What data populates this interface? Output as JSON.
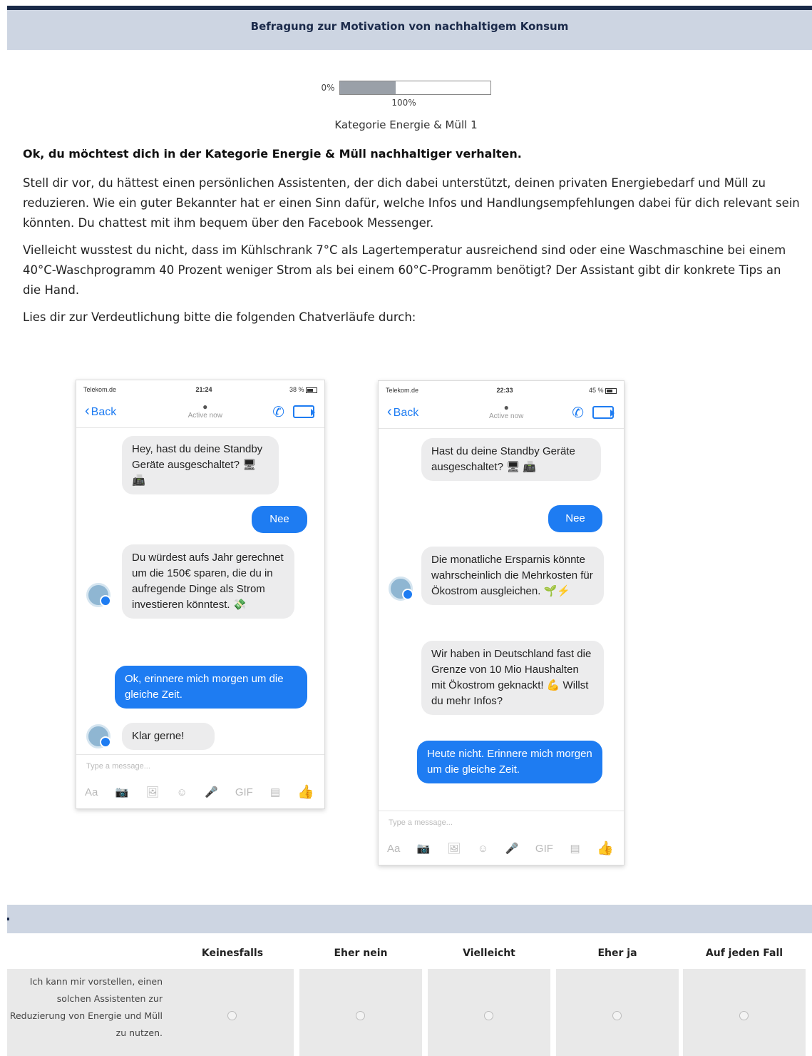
{
  "header": {
    "title": "Befragung zur Motivation von nachhaltigem Konsum"
  },
  "progress": {
    "min_label": "0%",
    "max_label": "100%",
    "fraction": 0.37
  },
  "category": "Kategorie Energie & Müll 1",
  "intro": {
    "heading": "Ok, du möchtest dich in der Kategorie Energie & Müll nachhaltiger verhalten.",
    "p1": "Stell dir vor, du hättest einen persönlichen Assistenten, der dich dabei unterstützt, deinen privaten Energiebedarf und Müll zu reduzieren. Wie ein guter Bekannter hat er einen Sinn dafür, welche Infos und Handlungsempfehlungen dabei für dich relevant sein könnten. Du chattest mit ihm bequem über den Facebook Messenger.",
    "p2": "Vielleicht wusstest du nicht, dass im Kühlschrank 7°C als Lagertemperatur ausreichend sind oder eine Waschmaschine bei einem 40°C-Waschprogramm 40 Prozent weniger Strom als bei einem 60°C-Programm benötigt? Der Assistant gibt dir konkrete Tips an die Hand.",
    "p3": "Lies dir zur Verdeutlichung bitte die folgenden Chatverläufe durch:"
  },
  "chat1": {
    "carrier": "Telekom.de",
    "time": "21:24",
    "battery": "38 %",
    "back": "Back",
    "active": "Active now",
    "composer_placeholder": "Type a message...",
    "messages": [
      "Hey, hast du deine Standby Geräte ausgeschaltet? 🖥📠",
      "Nee",
      "Du würdest aufs Jahr gerechnet um die 150€ sparen, die du in aufregende Dinge als Strom investieren könntest. 💸",
      "Ok, erinnere mich morgen um die gleiche Zeit.",
      "Klar gerne!"
    ]
  },
  "chat2": {
    "carrier": "Telekom.de",
    "time": "22:33",
    "battery": "45 %",
    "back": "Back",
    "active": "Active now",
    "composer_placeholder": "Type a message...",
    "messages": [
      "Hast du deine Standby Geräte ausgeschaltet? 🖥 📠",
      "Nee",
      "Die monatliche Ersparnis könnte wahrscheinlich die Mehrkosten für Ökostrom ausgleichen. 🌱⚡",
      "Wir haben in Deutschland fast die Grenze von 10 Mio Haushalten mit Ökostrom geknackt! 💪 Willst du mehr Infos?",
      "Heute nicht. Erinnere mich morgen um die gleiche Zeit."
    ]
  },
  "composer_tools": [
    "Aa",
    "📷",
    "🖼",
    "☺",
    "🎤",
    "GIF",
    "▤",
    "👍"
  ],
  "matrix": {
    "columns": [
      "Keinesfalls",
      "Eher nein",
      "Vielleicht",
      "Eher ja",
      "Auf jeden Fall"
    ],
    "row_label": "Ich kann mir vorstellen, einen solchen Assistenten zur Reduzierung von Energie und Müll zu nutzen."
  }
}
